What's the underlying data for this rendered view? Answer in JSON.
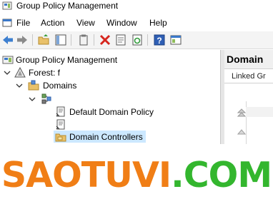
{
  "window": {
    "title": "Group Policy Management"
  },
  "menu": {
    "items": [
      "File",
      "Action",
      "View",
      "Window",
      "Help"
    ]
  },
  "toolbar": {
    "buttons": [
      "back-arrow-icon",
      "forward-arrow-icon",
      "up-folder-icon",
      "show-hide-tree-icon",
      "clipboard-icon",
      "delete-icon",
      "properties-icon",
      "refresh-icon",
      "help-icon",
      "console-icon"
    ]
  },
  "tree": {
    "root": "Group Policy Management",
    "forest": "Forest: f",
    "domains": "Domains",
    "domain_node": "",
    "default_policy": "Default Domain Policy",
    "unnamed_link": "",
    "domain_controllers": "Domain Controllers"
  },
  "right_pane": {
    "title": "Domain",
    "tab": "Linked Gr"
  },
  "watermark": {
    "part1": "SAOTUVI",
    "part2": ".COM"
  },
  "colors": {
    "selection": "#cce8ff",
    "watermark_orange": "#f07e16",
    "watermark_green": "#33b62e"
  }
}
